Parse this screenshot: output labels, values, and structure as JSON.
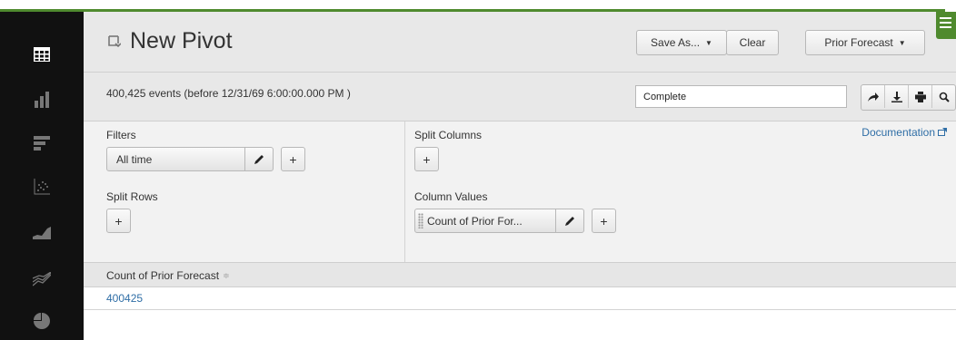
{
  "sidebar": {
    "icons": [
      "table-icon",
      "bar-chart-icon",
      "horizontal-bar-icon",
      "scatter-icon",
      "area-chart-icon",
      "line-chart-icon",
      "pie-chart-icon"
    ]
  },
  "header": {
    "title": "New Pivot",
    "save_as_label": "Save As...",
    "clear_label": "Clear",
    "dataset_label": "Prior Forecast"
  },
  "info": {
    "events_text": "400,425 events (before 12/31/69 6:00:00.000 PM )",
    "status_value": "Complete"
  },
  "config": {
    "filters_label": "Filters",
    "filter_value": "All time",
    "split_rows_label": "Split Rows",
    "split_columns_label": "Split Columns",
    "column_values_label": "Column Values",
    "column_value": "Count of Prior For...",
    "documentation_label": "Documentation",
    "plus": "+"
  },
  "table": {
    "columns": [
      "Count of Prior Forecast"
    ],
    "rows": [
      [
        "400425"
      ]
    ]
  },
  "colors": {
    "accent_green": "#4f8a2e",
    "link_blue": "#2f6ea6"
  }
}
